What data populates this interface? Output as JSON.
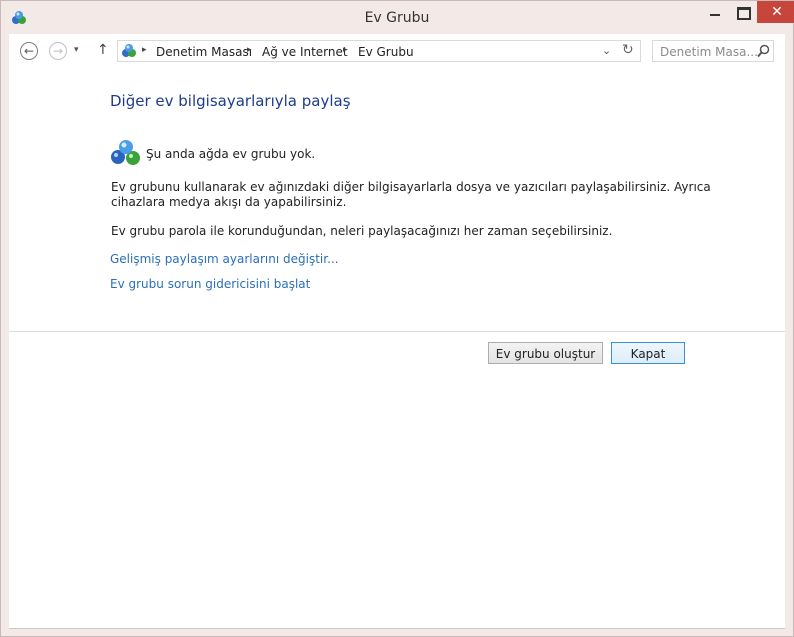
{
  "window": {
    "title": "Ev Grubu",
    "close_glyph": "✕"
  },
  "navbar": {
    "back_glyph": "←",
    "forward_glyph": "→",
    "recent_glyph": "▾",
    "up_glyph": "↑",
    "breadcrumbs": [
      "Denetim Masası",
      "Ağ ve Internet",
      "Ev Grubu"
    ],
    "crumb_separator": "▸",
    "address_dropdown_glyph": "⌄",
    "refresh_glyph": "↻",
    "search_placeholder": "Denetim Masa..."
  },
  "main": {
    "heading": "Diğer ev bilgisayarlarıyla paylaş",
    "status": "Şu anda ağda ev grubu yok.",
    "paragraph1": "Ev grubunu kullanarak ev ağınızdaki diğer bilgisayarlarla dosya ve yazıcıları paylaşabilirsiniz. Ayrıca cihazlara medya akışı da yapabilirsiniz.",
    "paragraph2": "Ev grubu parola ile korunduğundan, neleri paylaşacağınızı her zaman seçebilirsiniz.",
    "links": {
      "advanced_sharing": "Gelişmiş paylaşım ayarlarını değiştir...",
      "troubleshooter": "Ev grubu sorun gidericisini başlat"
    }
  },
  "footer": {
    "create_button": "Ev grubu oluştur",
    "close_button": "Kapat"
  },
  "colors": {
    "heading": "#1e3c8c",
    "link": "#2a6fb8",
    "close_button": "#c7463b"
  },
  "icons": [
    "homegroup-icon",
    "search-icon"
  ]
}
